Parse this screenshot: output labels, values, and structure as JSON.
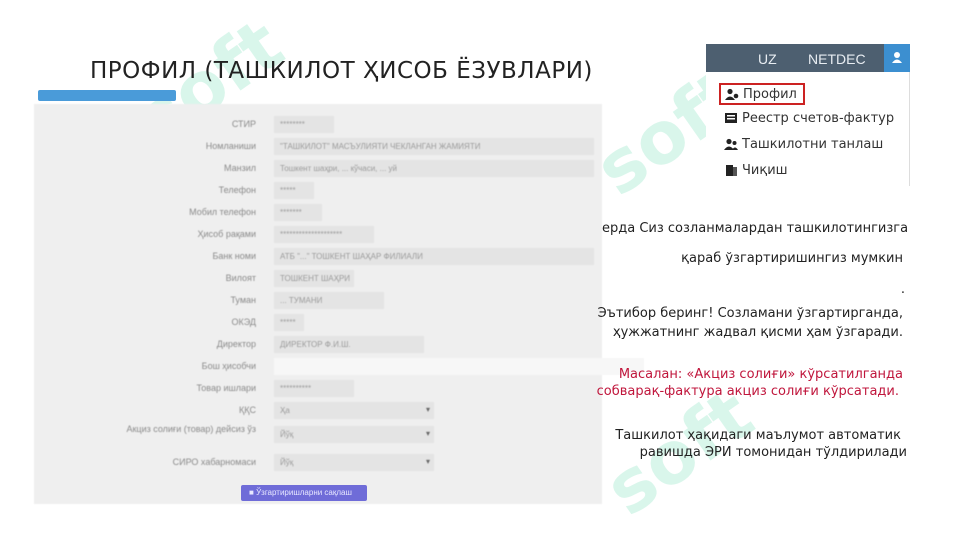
{
  "page_title": "ПРОФИЛ (ТАШКИЛОТ ҲИСОБ ЁЗУВЛАРИ)",
  "watermark": "soft",
  "menu": {
    "lang": "UZ",
    "user": "NETDEC",
    "items": [
      {
        "label": "Профил",
        "icon": "user-gear-icon"
      },
      {
        "label": "Реестр счетов-фактур",
        "icon": "registry-icon"
      },
      {
        "label": "Ташкилотни танлаш",
        "icon": "users-icon"
      },
      {
        "label": "Чиқиш",
        "icon": "exit-icon"
      }
    ]
  },
  "form": {
    "rows": [
      {
        "label": "СТИР",
        "value": "********"
      },
      {
        "label": "Номланиши",
        "value": "\"ТАШКИЛОТ\" МАСЪУЛИЯТИ ЧЕКЛАНГАН ЖАМИЯТИ"
      },
      {
        "label": "Манзил",
        "value": "Тошкент шаҳри, ... кўчаси, ... уй"
      },
      {
        "label": "Телефон",
        "value": "*****"
      },
      {
        "label": "Мобил телефон",
        "value": "*******"
      },
      {
        "label": "Ҳисоб рақами",
        "value": "********************"
      },
      {
        "label": "Банк номи",
        "value": "АТБ \"...\" ТОШКЕНТ ШАҲАР ФИЛИАЛИ"
      },
      {
        "label": "Вилоят",
        "value": "ТОШКЕНТ ШАҲРИ"
      },
      {
        "label": "Туман",
        "value": "... ТУМАНИ"
      },
      {
        "label": "ОКЭД",
        "value": "*****"
      },
      {
        "label": "Директор",
        "value": "ДИРЕКТОР Ф.И.Ш."
      },
      {
        "label": "Бош ҳисобчи",
        "value": ""
      },
      {
        "label": "Товар ишлари",
        "value": "**********"
      },
      {
        "label": "ҚҚС",
        "value": "Ҳа"
      },
      {
        "label": "Акциз солиғи (товар) дейсиз ўз",
        "value": "Йўқ"
      },
      {
        "label": "СИРО хабарномаси",
        "value": "Йўқ"
      }
    ],
    "save_label": "Ўзгартиришларни сақлаш"
  },
  "notes": {
    "n1": "ерда Сиз созланмалардан ташкилотингизга",
    "n2": "қараб ўзгартиришингиз мумкин",
    "n3": ".",
    "n4a": "Эътибор беринг! Созламани ўзгартирганда,",
    "n4b": "ҳужжатнинг жадвал қисми ҳам ўзгаради.",
    "n5a": "Масалан: «Акциз солиғи» кўрсатилганда",
    "n5b": "собварақ-фактура акциз солиғи кўрсатади.",
    "n6a": "Ташкилот ҳақидаги маълумот автоматик",
    "n6b": "равишда ЭРИ томонидан тўлдирилади"
  },
  "colors": {
    "accent_blue": "#3c8fd0",
    "topbar": "#4d5f70",
    "highlight_red": "#cc2222",
    "note_red": "#c0163c",
    "watermark": "#aaebd2"
  }
}
